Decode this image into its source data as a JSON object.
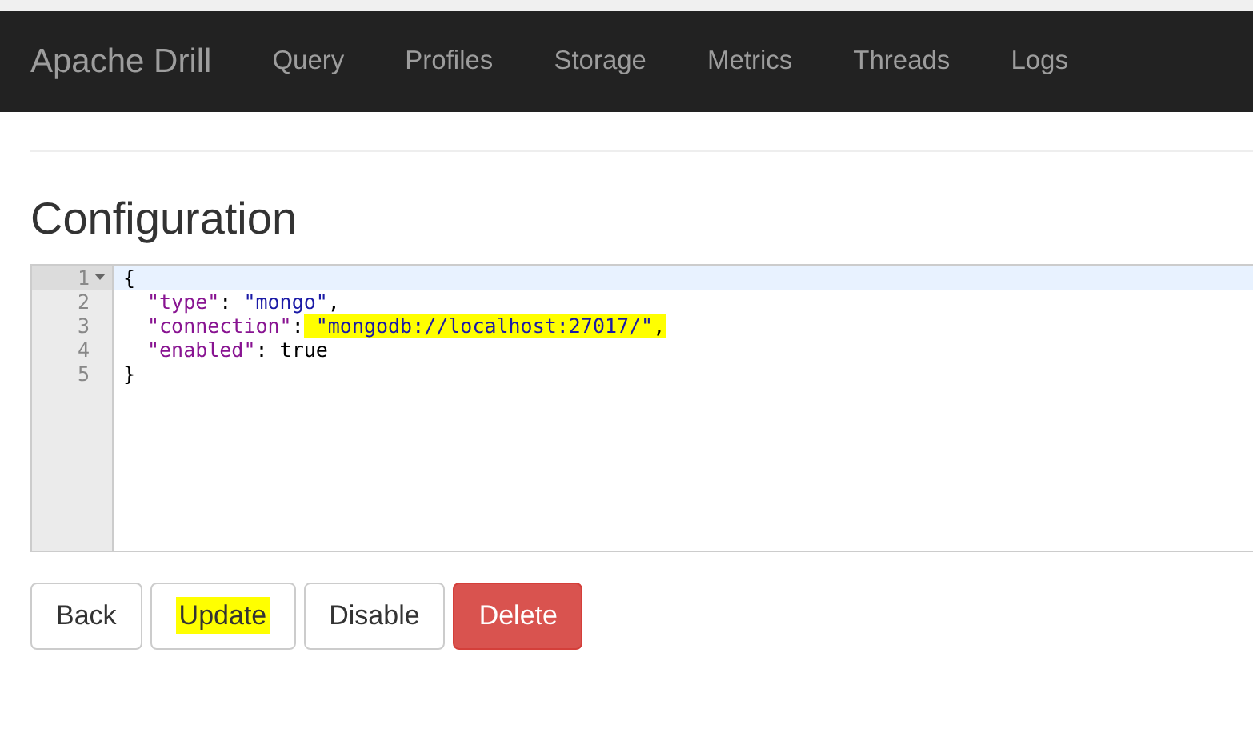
{
  "navbar": {
    "brand": "Apache Drill",
    "links": [
      "Query",
      "Profiles",
      "Storage",
      "Metrics",
      "Threads",
      "Logs"
    ]
  },
  "heading": "Configuration",
  "editor": {
    "lines": [
      {
        "number": "1",
        "kind": "open",
        "active": true,
        "foldable": true,
        "tokens": [
          {
            "kind": "punct",
            "text": "{",
            "highlighted": false
          }
        ]
      },
      {
        "number": "2",
        "kind": "member",
        "active": false,
        "foldable": false,
        "tokens": [
          {
            "kind": "key",
            "text": "\"type\"",
            "highlighted": false
          },
          {
            "kind": "punct",
            "text": ": ",
            "highlighted": false
          },
          {
            "kind": "string",
            "text": "\"mongo\"",
            "highlighted": false
          },
          {
            "kind": "punct",
            "text": ",",
            "highlighted": false
          }
        ]
      },
      {
        "number": "3",
        "kind": "member",
        "active": false,
        "foldable": false,
        "tokens": [
          {
            "kind": "key",
            "text": "\"connection\"",
            "highlighted": false
          },
          {
            "kind": "punct",
            "text": ":",
            "highlighted": false
          },
          {
            "kind": "string",
            "text": " \"mongodb://localhost:27017/\"",
            "highlighted": true
          },
          {
            "kind": "punct",
            "text": ",",
            "highlighted": true
          }
        ]
      },
      {
        "number": "4",
        "kind": "member",
        "active": false,
        "foldable": false,
        "tokens": [
          {
            "kind": "key",
            "text": "\"enabled\"",
            "highlighted": false
          },
          {
            "kind": "punct",
            "text": ": ",
            "highlighted": false
          },
          {
            "kind": "literal",
            "text": "true",
            "highlighted": false
          }
        ]
      },
      {
        "number": "5",
        "kind": "close",
        "active": false,
        "foldable": false,
        "tokens": [
          {
            "kind": "punct",
            "text": "}",
            "highlighted": false
          }
        ]
      }
    ]
  },
  "buttons": [
    {
      "label": "Back",
      "kind": "default",
      "highlighted": false
    },
    {
      "label": "Update",
      "kind": "default",
      "highlighted": true
    },
    {
      "label": "Disable",
      "kind": "default",
      "highlighted": false
    },
    {
      "label": "Delete",
      "kind": "danger",
      "highlighted": false
    }
  ]
}
